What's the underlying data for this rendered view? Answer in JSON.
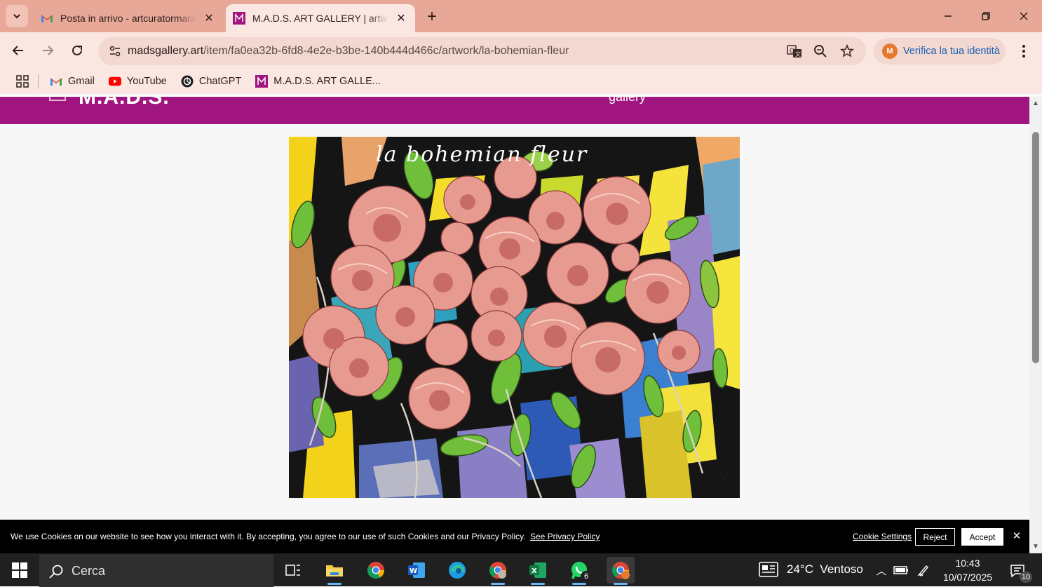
{
  "browser": {
    "tabs": [
      {
        "title": "Posta in arrivo - artcuratormara",
        "active": false,
        "icon": "gmail-icon"
      },
      {
        "title": "M.A.D.S. ART GALLERY | artwork",
        "active": true,
        "icon": "mads-icon"
      }
    ],
    "url": {
      "domain": "madsgallery.art",
      "path": "/item/fa0ea32b-6fd8-4e2e-b3be-140b444d466c/artwork/la-bohemian-fleur"
    },
    "profile_label": "Verifica la tua identità",
    "profile_initial": "M",
    "bookmarks": [
      {
        "label": "Gmail",
        "icon": "gmail-icon"
      },
      {
        "label": "YouTube",
        "icon": "youtube-icon"
      },
      {
        "label": "ChatGPT",
        "icon": "chatgpt-icon"
      },
      {
        "label": "M.A.D.S. ART GALLE...",
        "icon": "mads-icon"
      }
    ]
  },
  "page": {
    "header_color": "#a0157f",
    "artwork_title": "la bohemian fleur"
  },
  "cookie_banner": {
    "message": "We use Cookies on our website to see how you interact with it. By accepting, you agree to our use of such Cookies and our Privacy Policy.",
    "privacy_link": "See Privacy Policy",
    "settings": "Cookie Settings",
    "reject": "Reject",
    "accept": "Accept"
  },
  "taskbar": {
    "search_placeholder": "Cerca",
    "whatsapp_badge": "6",
    "weather": "24°C  Ventoso",
    "time": "10:43",
    "date": "10/07/2025",
    "notifications": "10"
  }
}
